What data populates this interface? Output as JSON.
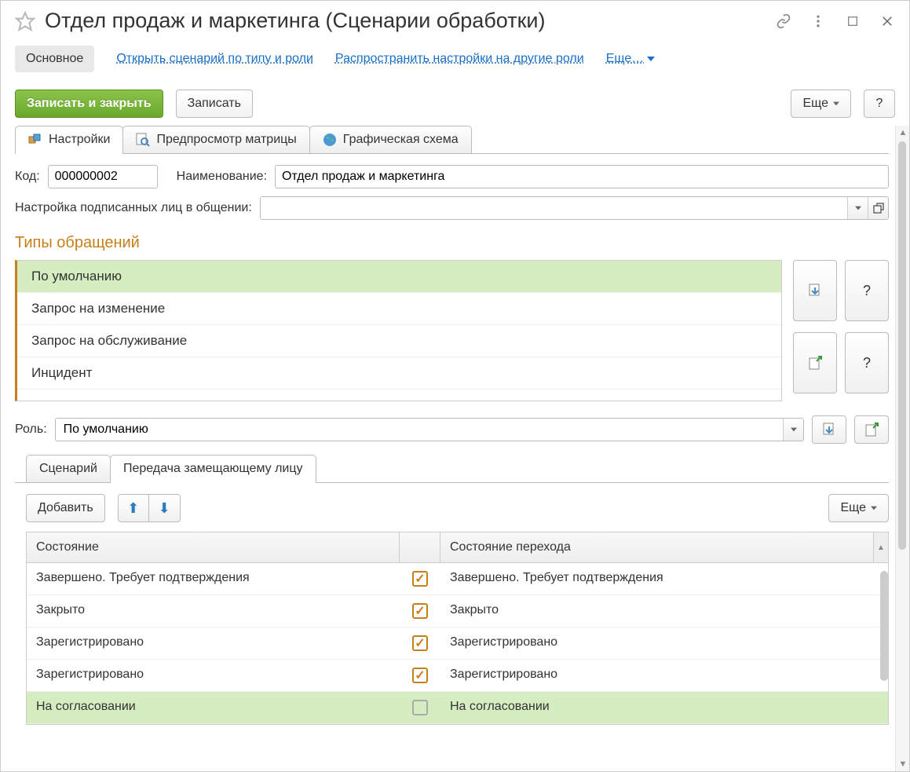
{
  "title": "Отдел продаж и маркетинга (Сценарии обработки)",
  "nav": {
    "main": "Основное",
    "link1": "Открыть сценарий по типу и роли",
    "link2": "Распространить настройки на другие роли",
    "more": "Еще…"
  },
  "toolbar": {
    "save_close": "Записать и закрыть",
    "save": "Записать",
    "more": "Еще",
    "help": "?"
  },
  "tabs": {
    "settings": "Настройки",
    "preview": "Предпросмотр матрицы",
    "graphic": "Графическая схема"
  },
  "form": {
    "code_label": "Код:",
    "code_value": "000000002",
    "name_label": "Наименование:",
    "name_value": "Отдел продаж и маркетинга",
    "signers_label": "Настройка подписанных лиц в общении:",
    "signers_value": ""
  },
  "types": {
    "title": "Типы обращений",
    "items": [
      "По умолчанию",
      "Запрос на изменение",
      "Запрос на обслуживание",
      "Инцидент"
    ],
    "help": "?"
  },
  "role": {
    "label": "Роль:",
    "value": "По умолчанию"
  },
  "subtabs": {
    "scenario": "Сценарий",
    "transfer": "Передача замещающему лицу"
  },
  "subtoolbar": {
    "add": "Добавить",
    "more": "Еще"
  },
  "table": {
    "col1": "Состояние",
    "col2": "Состояние перехода",
    "rows": [
      {
        "state": "Завершено. Требует подтверждения",
        "checked": true,
        "target": "Завершено. Требует подтверждения"
      },
      {
        "state": "Закрыто",
        "checked": true,
        "target": "Закрыто"
      },
      {
        "state": "Зарегистрировано",
        "checked": true,
        "target": "Зарегистрировано"
      },
      {
        "state": "Зарегистрировано",
        "checked": true,
        "target": "Зарегистрировано"
      },
      {
        "state": "На согласовании",
        "checked": false,
        "target": "На согласовании",
        "highlight": true
      }
    ]
  }
}
